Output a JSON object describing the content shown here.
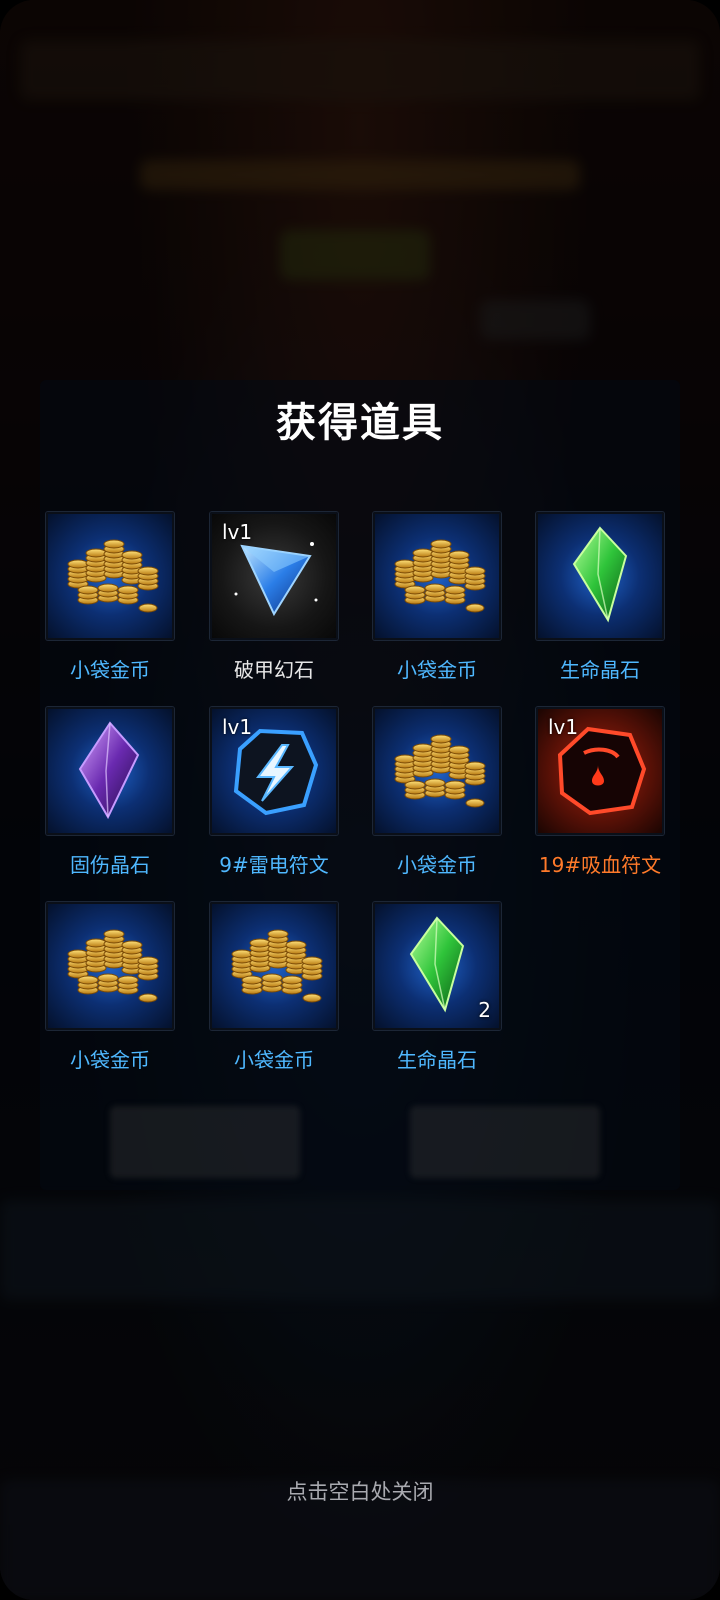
{
  "dialog": {
    "title": "获得道具",
    "close_hint": "点击空白处关闭"
  },
  "colors": {
    "label_blue": "#4fb8ff",
    "label_white": "#e8e8e8",
    "label_orange": "#ff7a2a"
  },
  "items": [
    {
      "name": "小袋金币",
      "icon": "gold-coins-icon",
      "level": "",
      "count": "",
      "color": "#4fb8ff",
      "bg": "blue"
    },
    {
      "name": "破甲幻石",
      "icon": "blue-gem-icon",
      "level": "lv1",
      "count": "",
      "color": "#e8e8e8",
      "bg": "dark"
    },
    {
      "name": "小袋金币",
      "icon": "gold-coins-icon",
      "level": "",
      "count": "",
      "color": "#4fb8ff",
      "bg": "blue"
    },
    {
      "name": "生命晶石",
      "icon": "green-crystal-icon",
      "level": "",
      "count": "",
      "color": "#4fb8ff",
      "bg": "blue"
    },
    {
      "name": "固伤晶石",
      "icon": "purple-crystal-icon",
      "level": "",
      "count": "",
      "color": "#4fb8ff",
      "bg": "blue"
    },
    {
      "name": "9#雷电符文",
      "icon": "lightning-rune-icon",
      "level": "lv1",
      "count": "",
      "color": "#4fb8ff",
      "bg": "blue"
    },
    {
      "name": "小袋金币",
      "icon": "gold-coins-icon",
      "level": "",
      "count": "",
      "color": "#4fb8ff",
      "bg": "blue"
    },
    {
      "name": "19#吸血符文",
      "icon": "blood-rune-icon",
      "level": "lv1",
      "count": "",
      "color": "#ff7a2a",
      "bg": "red"
    },
    {
      "name": "小袋金币",
      "icon": "gold-coins-icon",
      "level": "",
      "count": "",
      "color": "#4fb8ff",
      "bg": "blue"
    },
    {
      "name": "小袋金币",
      "icon": "gold-coins-icon",
      "level": "",
      "count": "",
      "color": "#4fb8ff",
      "bg": "blue"
    },
    {
      "name": "生命晶石",
      "icon": "green-crystal-icon",
      "level": "",
      "count": "2",
      "color": "#4fb8ff",
      "bg": "blue"
    }
  ]
}
